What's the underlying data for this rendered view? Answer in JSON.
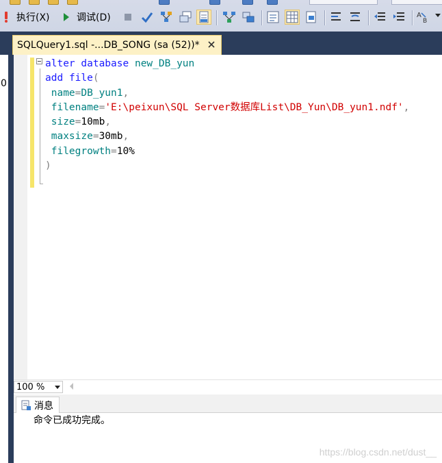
{
  "toolbar": {
    "execute_label": "执行(X)",
    "debug_label": "调试(D)",
    "colors": {
      "execute_red": "#e23b2e",
      "debug_green": "#1e8f3a",
      "check_blue": "#2f6ec5"
    }
  },
  "tab": {
    "title": "SQLQuery1.sql -...DB_SONG (sa (52))*"
  },
  "left_strip_char": "0",
  "editor": {
    "lines": [
      [
        {
          "t": "alter",
          "c": "kw"
        },
        {
          "t": " ",
          "c": "op"
        },
        {
          "t": "database",
          "c": "kw"
        },
        {
          "t": " ",
          "c": "op"
        },
        {
          "t": "new_DB_yun",
          "c": "id"
        }
      ],
      [
        {
          "t": "add",
          "c": "kw"
        },
        {
          "t": " ",
          "c": "op"
        },
        {
          "t": "file",
          "c": "kw"
        },
        {
          "t": "(",
          "c": "op"
        }
      ],
      [
        {
          "t": " ",
          "c": "op"
        },
        {
          "t": "name",
          "c": "id"
        },
        {
          "t": "=",
          "c": "op"
        },
        {
          "t": "DB_yun1",
          "c": "id"
        },
        {
          "t": ",",
          "c": "op"
        }
      ],
      [
        {
          "t": " ",
          "c": "op"
        },
        {
          "t": "filename",
          "c": "id"
        },
        {
          "t": "=",
          "c": "op"
        },
        {
          "t": "'E:\\peixun\\SQL Server数据库List\\DB_Yun\\DB_yun1.ndf'",
          "c": "str"
        },
        {
          "t": ",",
          "c": "op"
        }
      ],
      [
        {
          "t": " ",
          "c": "op"
        },
        {
          "t": "size",
          "c": "id"
        },
        {
          "t": "=",
          "c": "op"
        },
        {
          "t": "10mb",
          "c": "num"
        },
        {
          "t": ",",
          "c": "op"
        }
      ],
      [
        {
          "t": " ",
          "c": "op"
        },
        {
          "t": "maxsize",
          "c": "id"
        },
        {
          "t": "=",
          "c": "op"
        },
        {
          "t": "30mb",
          "c": "num"
        },
        {
          "t": ",",
          "c": "op"
        }
      ],
      [
        {
          "t": " ",
          "c": "op"
        },
        {
          "t": "filegrowth",
          "c": "id"
        },
        {
          "t": "=",
          "c": "op"
        },
        {
          "t": "10%",
          "c": "num"
        }
      ],
      [
        {
          "t": ")",
          "c": "op"
        }
      ]
    ]
  },
  "status": {
    "zoom": "100 %"
  },
  "results": {
    "messages_tab": "消息",
    "message": "命令已成功完成。"
  },
  "watermark": "https://blog.csdn.net/dust__"
}
